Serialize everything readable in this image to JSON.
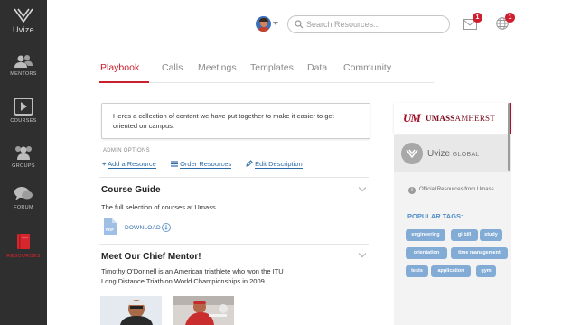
{
  "app": {
    "logo_text": "Uvize"
  },
  "sidebar": {
    "items": [
      {
        "label": "MENTORS",
        "icon": "users-icon"
      },
      {
        "label": "COURSES",
        "icon": "play-icon"
      },
      {
        "label": "GROUPS",
        "icon": "group-icon"
      },
      {
        "label": "FORUM",
        "icon": "chat-icon"
      },
      {
        "label": "RESOURCES",
        "icon": "book-icon",
        "active": true
      }
    ]
  },
  "header": {
    "search_placeholder": "Search Resources...",
    "mail_badge": "1",
    "globe_badge": "1"
  },
  "tabs": [
    "Playbook",
    "Calls",
    "Meetings",
    "Templates",
    "Data",
    "Community"
  ],
  "intro": {
    "text": "Heres a collection of content we have put together to make it easier to get oriented on campus."
  },
  "admin": {
    "title": "ADMIN OPTIONS",
    "add_resource": "Add a Resource",
    "order_resources": "Order Resources",
    "edit_description": "Edit Description"
  },
  "course_guide": {
    "title": "Course Guide",
    "description": "The full selection of courses at Umass.",
    "download_label": "DOWNLOAD"
  },
  "mentor": {
    "title": "Meet Our Chief Mentor!",
    "description": "Timothy O'Donnell is an American triathlete who won the ITU Long Distance Triathlon World Championships in 2009."
  },
  "right_panel": {
    "umass_logo": "UM",
    "umass_name_1": "UMASS",
    "umass_name_2": "AMHERST",
    "uvize_name": "Uvize",
    "uvize_global": "GLOBAL",
    "info_text": "Official Resources from Umass.",
    "tags_title": "POPULAR TAGS:",
    "tags": [
      "engineering",
      "gi bill",
      "study",
      "orientation",
      "time management",
      "tests",
      "application",
      "gym"
    ]
  },
  "colors": {
    "accent": "#c9202e",
    "link": "#2e6ca8",
    "tag": "#82abd6",
    "sidebar": "#2f2f2f"
  }
}
